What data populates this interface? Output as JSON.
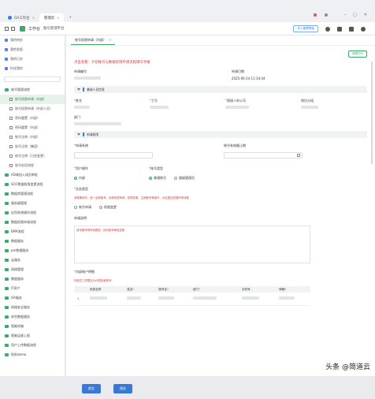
{
  "browser": {
    "tabs": [
      {
        "label": "OA工作台",
        "active": false
      },
      {
        "label": "管理云",
        "active": true
      }
    ],
    "account_items": [
      "",
      ""
    ]
  },
  "topbar": {
    "app_title": "工作台",
    "app_sub": "账号管理平台",
    "action_button": "切入管理界面"
  },
  "sidebar": {
    "top_items": [
      "我的待办",
      "我的发起",
      "我的已办",
      "抄送我的"
    ],
    "group_label": "账号管理流程",
    "sub_items": [
      {
        "label": "账号权限申请（内部）",
        "active": true
      },
      {
        "label": "账号权限申请（外部人员）",
        "active": false
      },
      {
        "label": "密码重置（内部）",
        "active": false
      },
      {
        "label": "密码重置（外部）",
        "active": false
      },
      {
        "label": "账号注销（内部）",
        "active": false
      },
      {
        "label": "账号注销（集团）",
        "active": false
      },
      {
        "label": "账号注销（已经变更）",
        "active": false
      },
      {
        "label": "账号启用流程",
        "active": false
      }
    ],
    "other_groups": [
      "AD域加入成员审批",
      "SOC数据权限变更流程",
      "数据库管理流程",
      "服务器管理",
      "应用系统操作流程",
      "数据权限申请流程",
      "BPM流程",
      "数据服务",
      "pm数据服务",
      "云服务",
      "网络管理",
      "数据服务",
      "IT资产",
      "OA服务",
      "网络安全服务",
      "综合数据服务",
      "智能终端",
      "智能运维上报",
      "用户上传数据流程",
      "财务demo"
    ]
  },
  "crumb": {
    "tab": "账号权限申请（内部）"
  },
  "form": {
    "print_button": "流程打印",
    "notice": "点击查看：计划账号与数据权限申请流程填写手册",
    "applicant_label": "申请编号",
    "date_label": "申请日期",
    "date_value": "2025-06-24 11:34:44",
    "section1": "基础人员信息",
    "name_label": "姓名",
    "emp_no_label": "工号",
    "company_label": "直接人的公司",
    "position_label": "岗位分组",
    "dept_label": "部门",
    "section2": "申请权限",
    "system_label": "申请系统",
    "validity_label": "账号有效截止期",
    "op_type_label": "用户操作",
    "op_opts": [
      "内部",
      "外部"
    ],
    "account_type_label": "账号类型",
    "acct_opts": [
      "普通账号",
      "超级管理员"
    ],
    "business_label": "业务类型",
    "business_note": "请按需填写，统一全新账号、全新权限申请、权限变更、注销账号等操作，对应提交权限申请流程",
    "biz_opts": [
      "账号申请",
      "权限变更"
    ],
    "reason_label": "申请说明",
    "reason_ph": "请详细写明申请原因，否则影响审批进度",
    "internal_label": "内部账户明细",
    "internal_note": "内部员工须限定为代表持有账号",
    "table_headers": [
      "系统名称",
      "姓名",
      "账号名",
      "部门",
      "手机号",
      "邮箱"
    ],
    "table_row_no": "1"
  },
  "footer": {
    "submit": "提交",
    "save": "保存"
  },
  "watermark": "头条 @简道云"
}
